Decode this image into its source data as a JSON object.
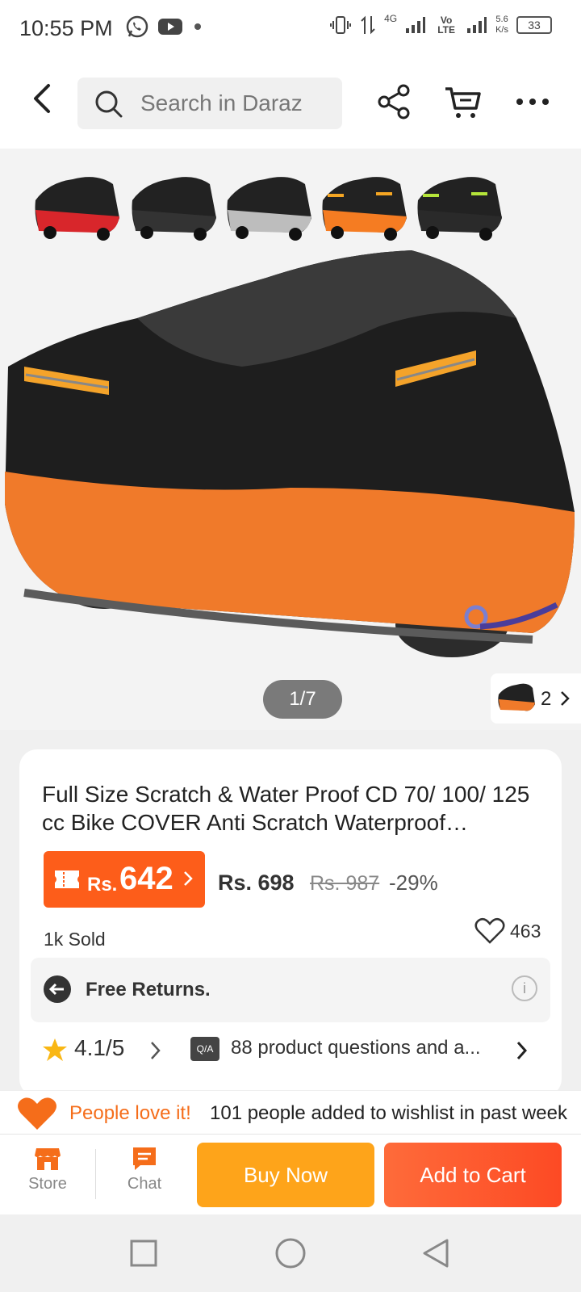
{
  "status": {
    "time": "10:55 PM",
    "net_speed_value": "5.6",
    "net_speed_unit": "K/s",
    "battery": "33",
    "net_label_1": "4G",
    "net_label_2": "Vo LTE"
  },
  "search": {
    "placeholder": "Search in Daraz"
  },
  "gallery": {
    "counter": "1/7",
    "more_count": "2",
    "variants": [
      "black-red",
      "black",
      "black-silver",
      "black-orange",
      "black-green"
    ]
  },
  "product": {
    "title": "Full Size Scratch & Water Proof CD 70/ 100/ 125 cc Bike COVER Anti Scratch Waterproof…",
    "voucher_currency": "Rs.",
    "voucher_price": "642",
    "price": "Rs. 698",
    "original_price": "Rs. 987",
    "discount": "-29%",
    "sold": "1k Sold",
    "wishlist_count": "463",
    "returns_label": "Free Returns.",
    "rating": "4.1/5",
    "qa_badge": "Q/A",
    "qa_text": "88 product questions and a..."
  },
  "banner": {
    "highlight": "People love it!",
    "text": "101 people added to wishlist in past week"
  },
  "bottom_bar": {
    "store_label": "Store",
    "chat_label": "Chat",
    "buy_now": "Buy Now",
    "add_to_cart": "Add to Cart"
  },
  "colors": {
    "accent": "#fd5d1a",
    "buy": "#fea41a",
    "cart": "#fd4a24"
  }
}
